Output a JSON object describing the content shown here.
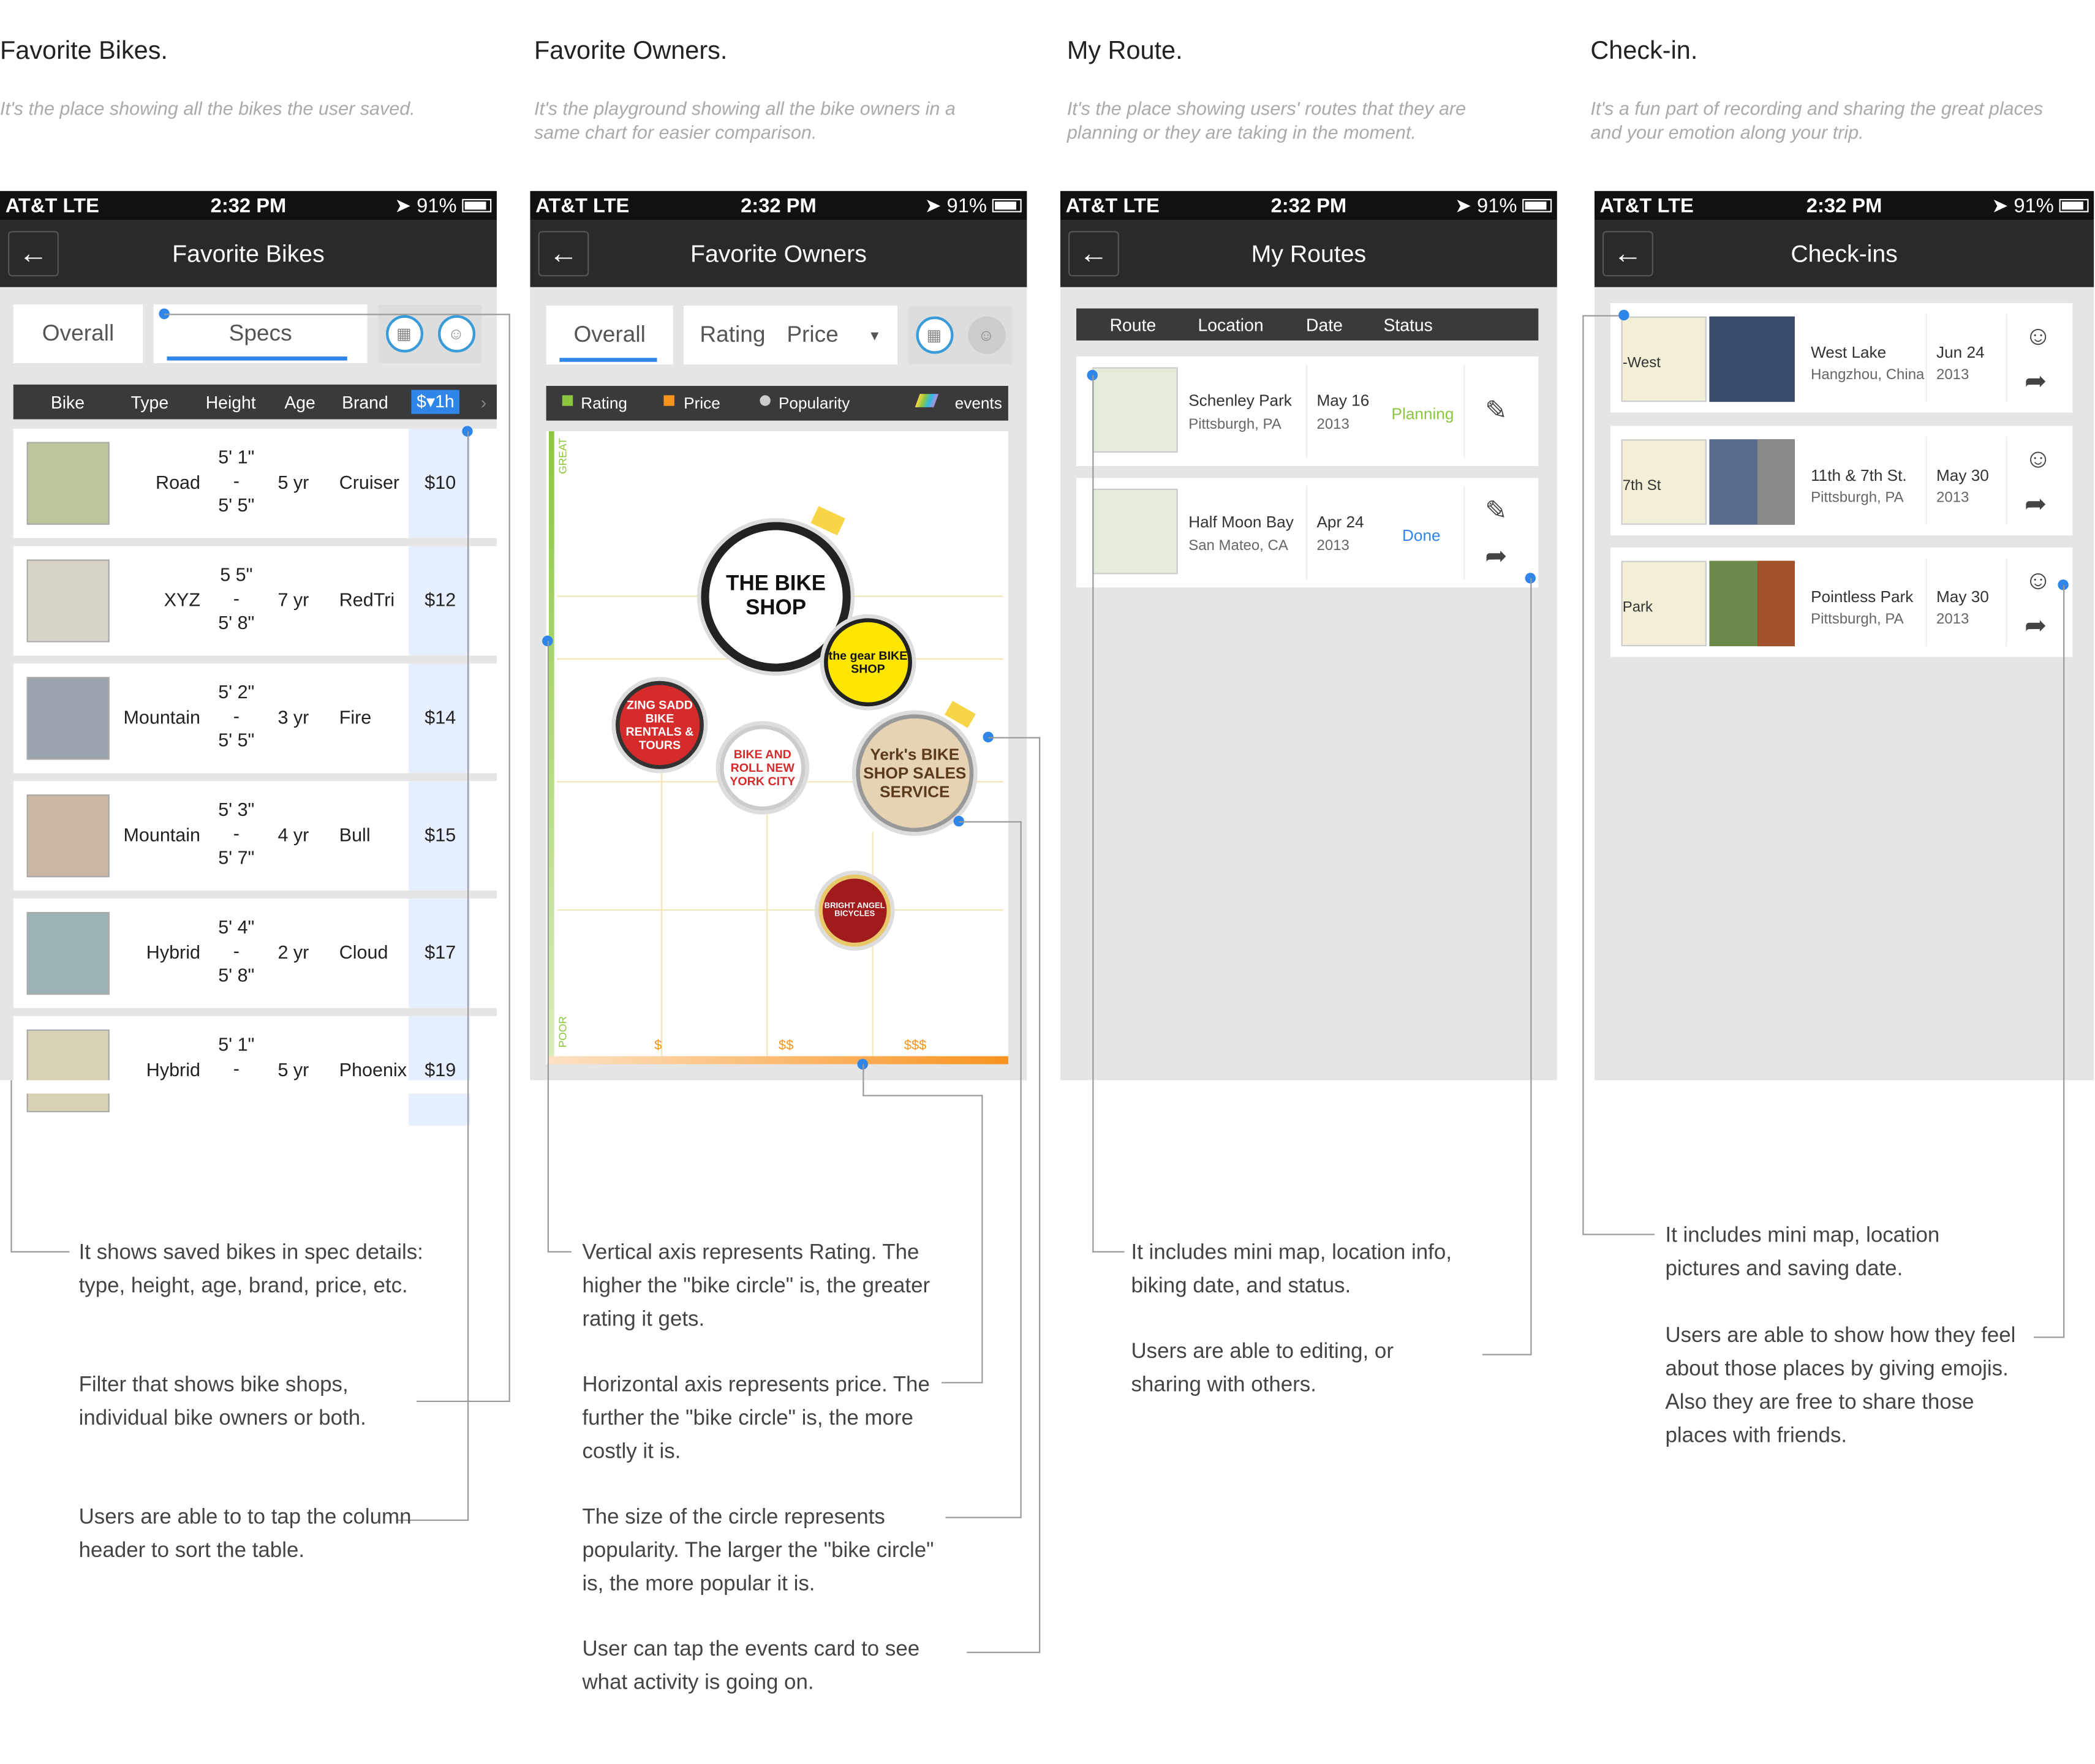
{
  "status": {
    "carrier": "AT&T  LTE",
    "time": "2:32 PM",
    "battery": "91%"
  },
  "sections": [
    {
      "title": "Favorite Bikes.",
      "desc": "It's the place showing all the bikes the user saved."
    },
    {
      "title": "Favorite Owners.",
      "desc": "It's the playground showing all the bike owners in a same chart for easier comparison."
    },
    {
      "title": "My Route.",
      "desc": "It's the place showing users' routes that they are planning or they are taking in the moment."
    },
    {
      "title": "Check-in.",
      "desc": "It's a fun part of recording and sharing the great places and your emotion along your trip."
    }
  ],
  "bikes": {
    "title": "Favorite Bikes",
    "tab_overall": "Overall",
    "tab_specs": "Specs",
    "headers": [
      "Bike",
      "Type",
      "Height",
      "Age",
      "Brand",
      "$▾1h"
    ],
    "rows": [
      {
        "type": "Road",
        "h1": "5' 1\"",
        "h2": "5' 5\"",
        "age": "5 yr",
        "brand": "Cruiser",
        "price": "$10"
      },
      {
        "type": "XYZ",
        "h1": "5 5\"",
        "h2": "5' 8\"",
        "age": "7 yr",
        "brand": "RedTri",
        "price": "$12"
      },
      {
        "type": "Mountain",
        "h1": "5' 2\"",
        "h2": "5' 5\"",
        "age": "3 yr",
        "brand": "Fire",
        "price": "$14"
      },
      {
        "type": "Mountain",
        "h1": "5' 3\"",
        "h2": "5' 7\"",
        "age": "4 yr",
        "brand": "Bull",
        "price": "$15"
      },
      {
        "type": "Hybrid",
        "h1": "5' 4\"",
        "h2": "5' 8\"",
        "age": "2 yr",
        "brand": "Cloud",
        "price": "$17"
      },
      {
        "type": "Hybrid",
        "h1": "5' 1\"",
        "h2": "",
        "age": "5 yr",
        "brand": "Phoenix",
        "price": "$19"
      }
    ],
    "dash": "-",
    "notes": [
      "It shows saved bikes in spec details: type, height, age, brand, price, etc.",
      "Filter that shows bike shops, individual bike owners or both.",
      "Users are able to to tap the column header to sort the table."
    ]
  },
  "owners": {
    "title": "Favorite Owners",
    "tab_overall": "Overall",
    "tab_rating": "Rating",
    "tab_price": "Price",
    "dropdown": "▾",
    "legend": [
      "Rating",
      "Price",
      "Popularity",
      "events"
    ],
    "axis_great": "GREAT",
    "axis_poor": "POOR",
    "ticks": [
      "$",
      "$$",
      "$$$"
    ],
    "logos": [
      "THE BIKE SHOP",
      "the gear BIKE SHOP",
      "ZING SADD BIKE RENTALS & TOURS",
      "BIKE AND ROLL NEW YORK CITY",
      "Yerk's BIKE SHOP SALES SERVICE",
      "BRIGHT ANGEL BICYCLES"
    ],
    "notes": [
      "Vertical axis represents Rating. The higher the \"bike circle\" is, the greater rating it gets.",
      "Horizontal axis represents price. The further the \"bike circle\" is, the more costly it is.",
      "The size of the circle represents popularity. The larger the \"bike circle\" is, the more popular it is.",
      "User can tap the events card to see what activity is going on."
    ]
  },
  "routes": {
    "title": "My Routes",
    "headers": [
      "Route",
      "Location",
      "Date",
      "Status"
    ],
    "items": [
      {
        "name": "Schenley Park",
        "loc": "Pittsburgh, PA",
        "date": "May 16",
        "year": "2013",
        "status": "Planning",
        "status_color": "#8cc63f"
      },
      {
        "name": "Half Moon Bay",
        "loc": "San Mateo, CA",
        "date": "Apr 24",
        "year": "2013",
        "status": "Done",
        "status_color": "#2f86e8"
      }
    ],
    "notes": [
      "It includes mini map, location info, biking date, and status.",
      "Users are able to editing, or sharing with others."
    ]
  },
  "checkins": {
    "title": "Check-ins",
    "items": [
      {
        "name": "West Lake",
        "loc": "Hangzhou, China",
        "date": "Jun 24",
        "year": "2013",
        "map": "-West"
      },
      {
        "name": "11th & 7th St.",
        "loc": "Pittsburgh, PA",
        "date": "May 30",
        "year": "2013",
        "map": "7th St"
      },
      {
        "name": "Pointless Park",
        "loc": "Pittsburgh, PA",
        "date": "May 30",
        "year": "2013",
        "map": "Park"
      }
    ],
    "notes": [
      "It includes mini map, location pictures and saving date.",
      "Users are able to show how they feel about those places by giving emojis. Also they are free to share those places with friends."
    ]
  }
}
